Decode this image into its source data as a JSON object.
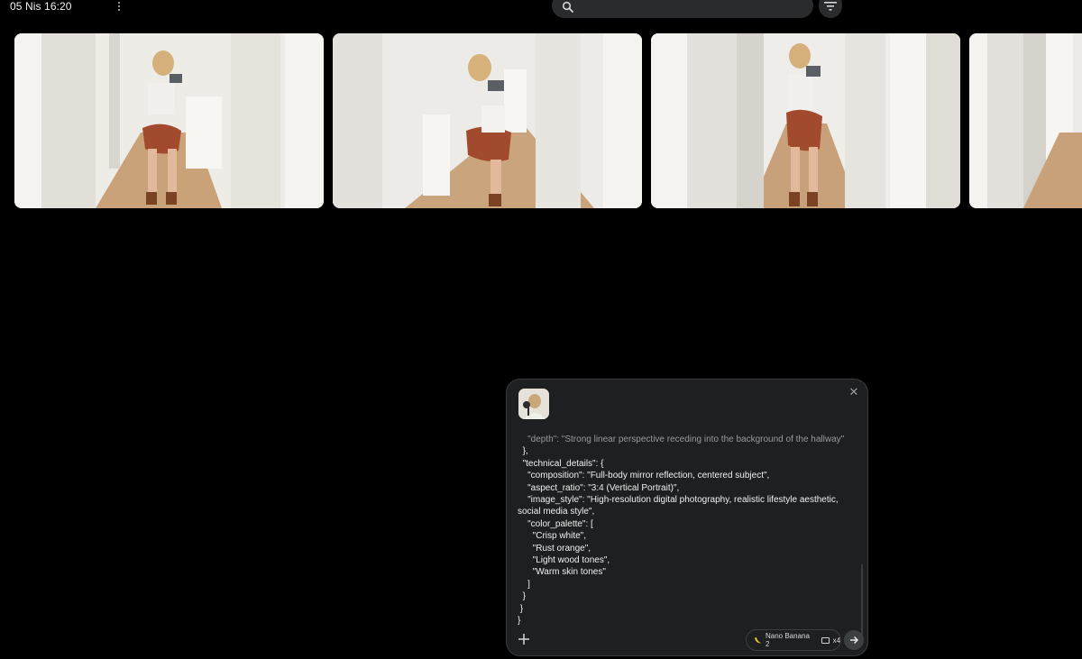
{
  "topbar": {
    "timestamp": "05 Nis 16:20",
    "search": {
      "placeholder": "",
      "value": ""
    }
  },
  "gallery": {
    "images": [
      {
        "icon": "photo-woman-mirror-selfie-hallway-1"
      },
      {
        "icon": "photo-woman-mirror-selfie-hallway-2"
      },
      {
        "icon": "photo-woman-mirror-selfie-hallway-3"
      },
      {
        "icon": "photo-woman-mirror-selfie-hallway-4"
      }
    ]
  },
  "composer": {
    "prompt_lines": [
      {
        "text": "    \"depth\": \"Strong linear perspective receding into the background of the hallway\"",
        "faded": true
      },
      {
        "text": "  },",
        "faded": false
      },
      {
        "text": "  \"technical_details\": {",
        "faded": false
      },
      {
        "text": "    \"composition\": \"Full-body mirror reflection, centered subject\",",
        "faded": false
      },
      {
        "text": "    \"aspect_ratio\": \"3:4 (Vertical Portrait)\",",
        "faded": false
      },
      {
        "text": "    \"image_style\": \"High-resolution digital photography, realistic lifestyle aesthetic,",
        "faded": false
      },
      {
        "text": "social media style\",",
        "faded": false
      },
      {
        "text": "    \"color_palette\": [",
        "faded": false
      },
      {
        "text": "      \"Crisp white\",",
        "faded": false
      },
      {
        "text": "      \"Rust orange\",",
        "faded": false
      },
      {
        "text": "      \"Light wood tones\",",
        "faded": false
      },
      {
        "text": "      \"Warm skin tones\"",
        "faded": false
      },
      {
        "text": "    ]",
        "faded": false
      },
      {
        "text": "  }",
        "faded": false
      },
      {
        "text": " }",
        "faded": false
      },
      {
        "text": "}",
        "faded": false
      }
    ],
    "model_label": "Nano Banana 2",
    "count_label": "x4"
  },
  "colors": {
    "background": "#000000",
    "panel": "#1e1f20",
    "wall": "#ece9e3",
    "shorts": "#a24a2e",
    "floor": "#c9a27a"
  }
}
